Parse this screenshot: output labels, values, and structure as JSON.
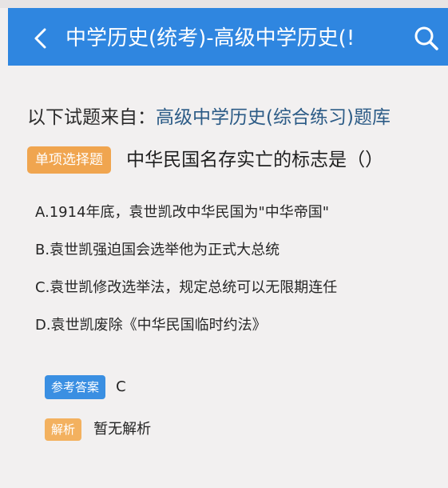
{
  "header": {
    "back_icon": "chevron-left-icon",
    "title": "中学历史(统考)-高级中学历史(!",
    "search_icon": "search-icon",
    "color": "#2f86e0"
  },
  "source": {
    "label": "以下试题来自：",
    "bank_name": "高级中学历史(综合练习)题库"
  },
  "question": {
    "type_badge": "单项选择题",
    "text": "中华民国名存实亡的标志是（）",
    "options": [
      "A.1914年底，袁世凯改中华民国为\"中华帝国\"",
      "B.袁世凯强迫国会选举他为正式大总统",
      "C.袁世凯修改选举法，规定总统可以无限期连任",
      "D.袁世凯废除《中华民国临时约法》"
    ]
  },
  "answer": {
    "badge": "参考答案",
    "value": "C"
  },
  "analysis": {
    "badge": "解析",
    "value": "暂无解析"
  }
}
